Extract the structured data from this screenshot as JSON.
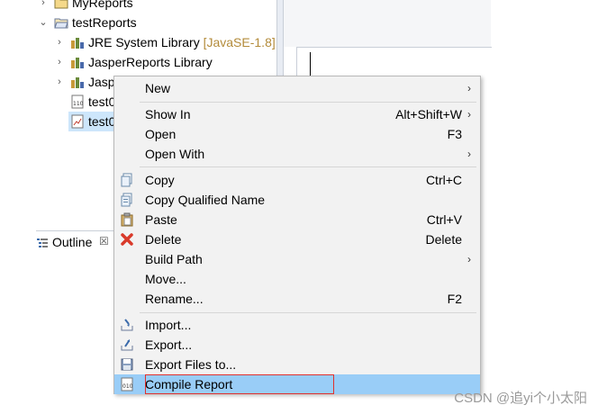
{
  "tree": {
    "items": [
      {
        "label": "MyReports",
        "decoration": ""
      },
      {
        "label": "testReports",
        "decoration": ""
      },
      {
        "label": "JRE System Library",
        "decoration": "[JavaSE-1.8]"
      },
      {
        "label": "JasperReports Library",
        "decoration": ""
      },
      {
        "label": "Jasp",
        "decoration": ""
      },
      {
        "label": "test0",
        "decoration": ""
      },
      {
        "label": "test0",
        "decoration": ""
      }
    ]
  },
  "outline": {
    "label": "Outline",
    "close_glyph": "☒"
  },
  "context_menu": {
    "items": [
      {
        "label": "New",
        "shortcut": ""
      },
      {
        "label": "Show In",
        "shortcut": "Alt+Shift+W"
      },
      {
        "label": "Open",
        "shortcut": "F3"
      },
      {
        "label": "Open With",
        "shortcut": ""
      },
      {
        "label": "Copy",
        "shortcut": "Ctrl+C"
      },
      {
        "label": "Copy Qualified Name",
        "shortcut": ""
      },
      {
        "label": "Paste",
        "shortcut": "Ctrl+V"
      },
      {
        "label": "Delete",
        "shortcut": "Delete"
      },
      {
        "label": "Build Path",
        "shortcut": ""
      },
      {
        "label": "Move...",
        "shortcut": ""
      },
      {
        "label": "Rename...",
        "shortcut": "F2"
      },
      {
        "label": "Import...",
        "shortcut": ""
      },
      {
        "label": "Export...",
        "shortcut": ""
      },
      {
        "label": "Export Files to...",
        "shortcut": ""
      },
      {
        "label": "Compile Report",
        "shortcut": ""
      }
    ],
    "submenu_glyph": "›"
  },
  "watermark": "CSDN @追yi个小太阳",
  "colors": {
    "selection": "#99cdf7",
    "highlight_border": "#e0312e",
    "menu_bg": "#f2f2f2"
  }
}
